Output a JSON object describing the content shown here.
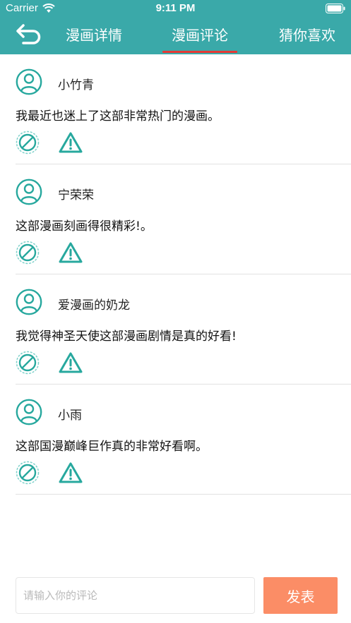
{
  "status_bar": {
    "carrier": "Carrier",
    "time": "9:11 PM"
  },
  "nav": {
    "tabs": [
      {
        "label": "漫画详情",
        "active": false
      },
      {
        "label": "漫画评论",
        "active": true
      },
      {
        "label": "猜你喜欢",
        "active": false
      }
    ]
  },
  "comments": [
    {
      "user": "小竹青",
      "text": "我最近也迷上了这部非常热门的漫画。"
    },
    {
      "user": "宁荣荣",
      "text": "这部漫画刻画得很精彩!。"
    },
    {
      "user": "爱漫画的奶龙",
      "text": "我觉得神圣天使这部漫画剧情是真的好看!"
    },
    {
      "user": "小雨",
      "text": "这部国漫巅峰巨作真的非常好看啊。"
    }
  ],
  "composer": {
    "placeholder": "请输入你的评论",
    "value": "",
    "send_label": "发表"
  },
  "colors": {
    "nav_bg": "#3aa9a9",
    "tab_indicator": "#e53935",
    "icon_teal": "#27a89e",
    "send_button": "#fb8d66"
  }
}
